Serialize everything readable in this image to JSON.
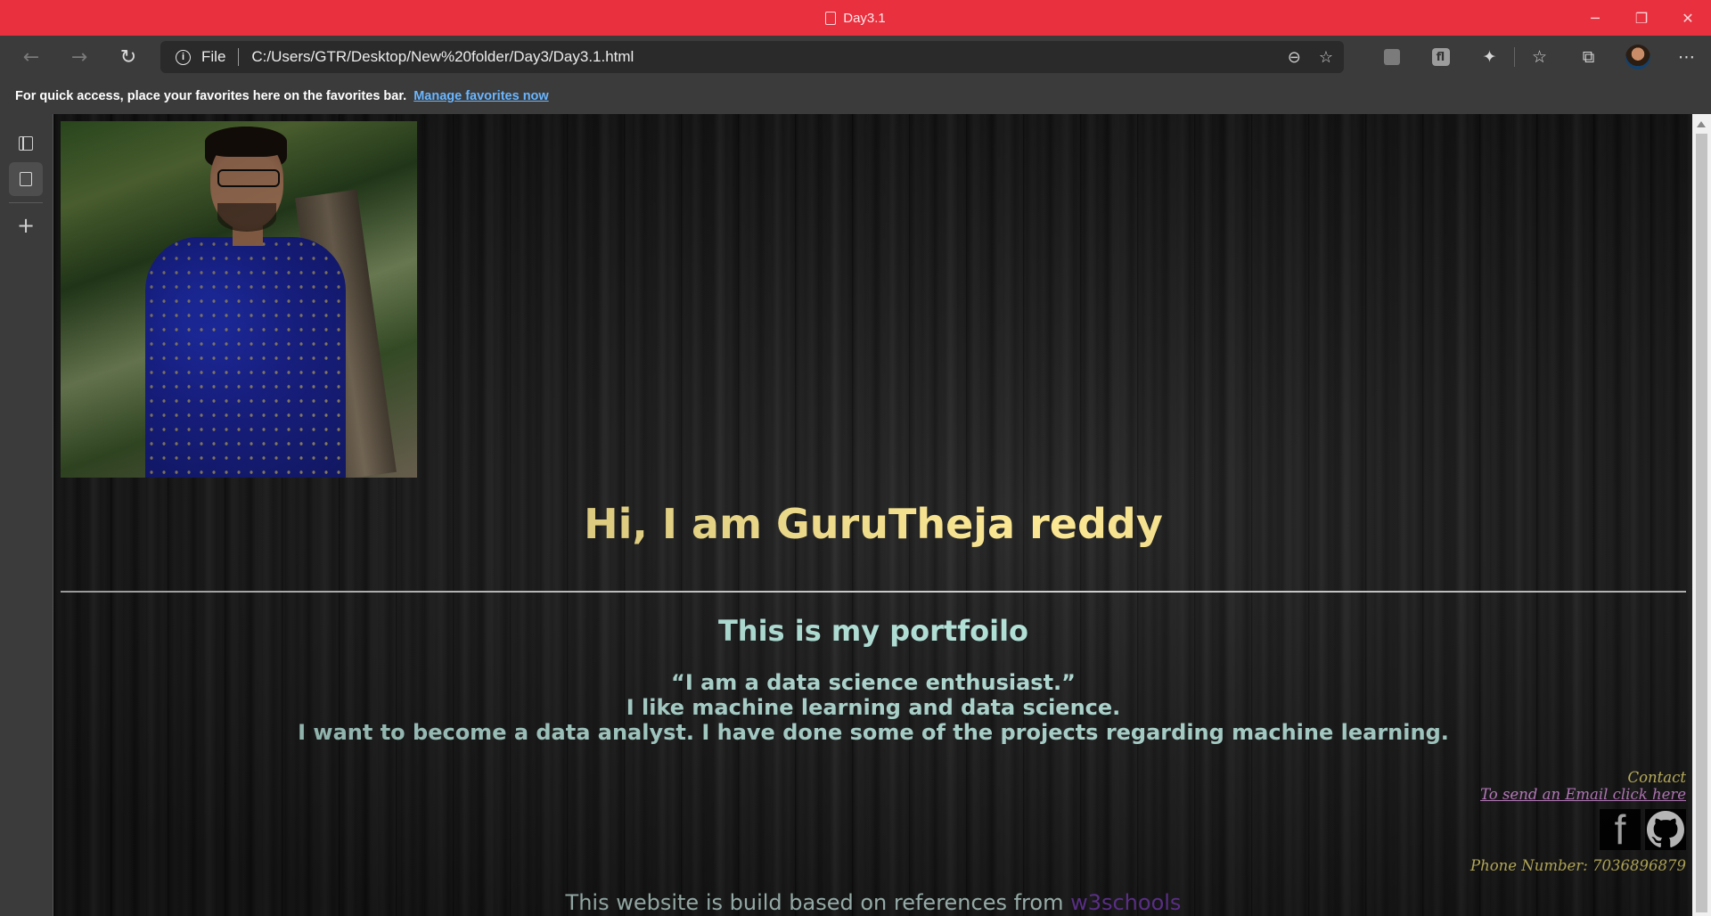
{
  "window": {
    "title": "Day3.1",
    "minimize_icon": "minimize-icon",
    "restore_icon": "restore-icon",
    "close_icon": "close-icon"
  },
  "navigation": {
    "back_icon": "back-arrow-icon",
    "forward_icon": "forward-arrow-icon",
    "refresh_icon": "refresh-icon",
    "address": {
      "scheme_label": "File",
      "url": "C:/Users/GTR/Desktop/New%20folder/Day3/Day3.1.html"
    }
  },
  "favorites_bar": {
    "message": "For quick access, place your favorites here on the favorites bar.",
    "link": "Manage favorites now"
  },
  "page": {
    "heading": "Hi, I am GuruTheja reddy",
    "subheading": "This is my portfoilo",
    "bio": [
      "“I am a data science enthusiast.”",
      "I like machine learning and data science.",
      "I want to become a data analyst. I have done some of the projects regarding machine learning."
    ],
    "contact": {
      "label": "Contact",
      "email_link": "To send an Email click here",
      "facebook_glyph": "f",
      "phone": "Phone Number: 7036896879"
    },
    "footer": {
      "text": "This website is build based on references from ",
      "reference": "w3schools"
    }
  },
  "colors": {
    "titlebar": "#e8303f",
    "heading": "#fde88f",
    "subheading": "#bff4e9",
    "contact": "#f6e676",
    "email_link": "#ec9bf2",
    "footer_link": "#7a3db8"
  }
}
